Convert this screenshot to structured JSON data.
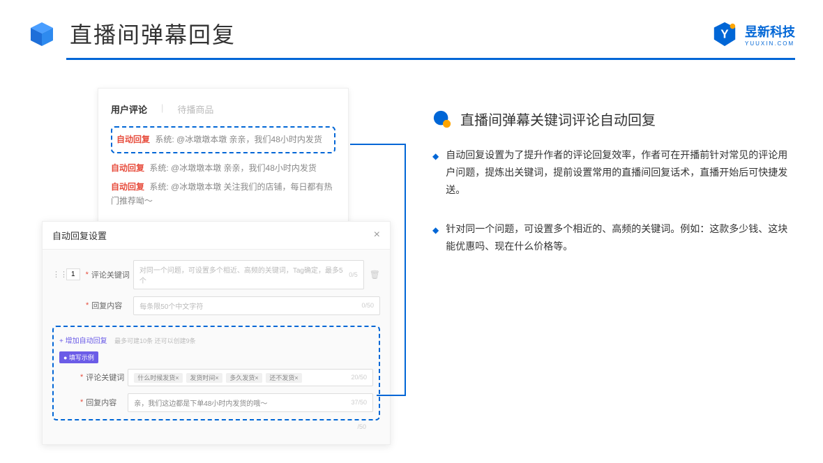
{
  "header": {
    "title": "直播间弹幕回复"
  },
  "brand": {
    "name": "昱新科技",
    "url": "YUUXIN.COM"
  },
  "commentsPanel": {
    "tab1": "用户评论",
    "tab2": "待播商品",
    "highlighted": {
      "tag": "自动回复",
      "text": "系统: @冰墩墩本墩 亲亲，我们48小时内发货"
    },
    "line2": {
      "tag": "自动回复",
      "text": "系统: @冰墩墩本墩 亲亲，我们48小时内发货"
    },
    "line3": {
      "tag": "自动回复",
      "text": "系统: @冰墩墩本墩 关注我们的店铺，每日都有热门推荐呦～"
    }
  },
  "settingsPanel": {
    "title": "自动回复设置",
    "rowNum": "1",
    "keywordLabel": "评论关键词",
    "keywordPlaceholder": "对同一个问题，可设置多个相近、高频的关键词，Tag确定，最多5个",
    "keywordCounter": "0/5",
    "contentLabel": "回复内容",
    "contentPlaceholder": "每条限50个中文字符",
    "contentCounter": "0/50",
    "addLink": "+ 增加自动回复",
    "addHint": "最多可建10条 还可以创建9条",
    "exampleBadge": "● 填写示例",
    "exKeywordLabel": "评论关键词",
    "exTag1": "什么时候发货×",
    "exTag2": "发货时间×",
    "exTag3": "多久发货×",
    "exTag4": "还不发货×",
    "exKeywordCounter": "20/50",
    "exContentLabel": "回复内容",
    "exContentText": "亲，我们这边都是下单48小时内发货的哦～",
    "exContentCounter": "37/50",
    "bottomCounter": "/50"
  },
  "rightSection": {
    "title": "直播间弹幕关键词评论自动回复",
    "bullet1": "自动回复设置为了提升作者的评论回复效率，作者可在开播前针对常见的评论用户问题，提炼出关键词，提前设置常用的直播间回复话术，直播开始后可快捷发送。",
    "bullet2": "针对同一个问题，可设置多个相近的、高频的关键词。例如：这款多少钱、这块能优惠吗、现在什么价格等。"
  }
}
